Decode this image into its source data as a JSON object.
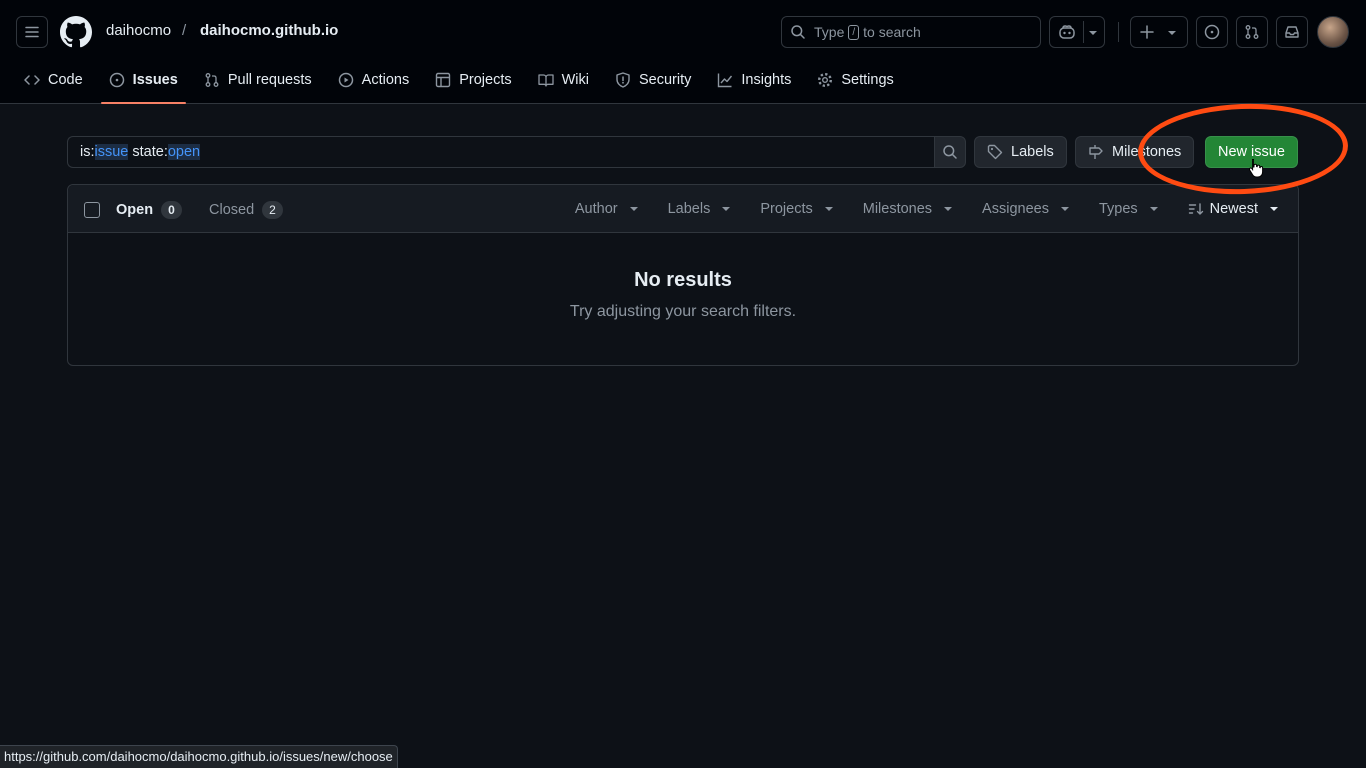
{
  "header": {
    "owner": "daihocmo",
    "separator": "/",
    "repo": "daihocmo.github.io",
    "search": {
      "prefix": "Type",
      "key": "/",
      "suffix": "to search"
    }
  },
  "tabs": [
    {
      "label": "Code",
      "icon": "code-icon"
    },
    {
      "label": "Issues",
      "icon": "issue-opened-icon",
      "active": true
    },
    {
      "label": "Pull requests",
      "icon": "git-pull-request-icon"
    },
    {
      "label": "Actions",
      "icon": "play-icon"
    },
    {
      "label": "Projects",
      "icon": "table-icon"
    },
    {
      "label": "Wiki",
      "icon": "book-icon"
    },
    {
      "label": "Security",
      "icon": "shield-icon"
    },
    {
      "label": "Insights",
      "icon": "graph-icon"
    },
    {
      "label": "Settings",
      "icon": "gear-icon"
    }
  ],
  "filter": {
    "p1": "is:",
    "v1": "issue",
    "p2": " state:",
    "v2": "open"
  },
  "toolbar": {
    "labels": "Labels",
    "milestones": "Milestones",
    "new_issue": "New issue"
  },
  "list": {
    "open_label": "Open",
    "open_count": "0",
    "closed_label": "Closed",
    "closed_count": "2",
    "filters": [
      "Author",
      "Labels",
      "Projects",
      "Milestones",
      "Assignees",
      "Types"
    ],
    "sort": "Newest"
  },
  "empty": {
    "title": "No results",
    "subtitle": "Try adjusting your search filters."
  },
  "status_url": "https://github.com/daihocmo/daihocmo.github.io/issues/new/choose",
  "colors": {
    "background": "#0d1117",
    "accent": "#238636",
    "active_tab": "#f78166",
    "highlight_ring": "#ff4b12"
  }
}
